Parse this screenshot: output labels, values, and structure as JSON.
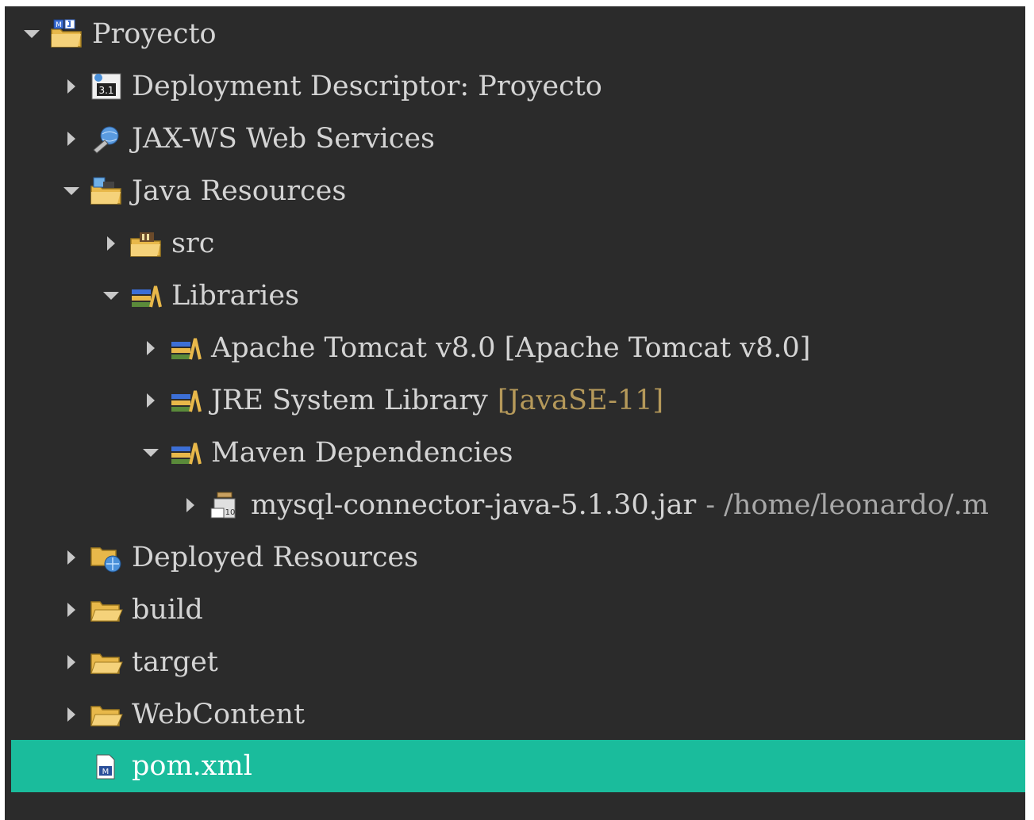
{
  "tree": {
    "items": [
      {
        "label": "Proyecto",
        "level": 0,
        "state": "expanded",
        "icon": "maven-web-project-icon"
      },
      {
        "label": "Deployment Descriptor: Proyecto",
        "level": 1,
        "state": "collapsed",
        "icon": "deployment-descriptor-icon"
      },
      {
        "label": "JAX-WS Web Services",
        "level": 1,
        "state": "collapsed",
        "icon": "web-services-icon"
      },
      {
        "label": "Java Resources",
        "level": 1,
        "state": "expanded",
        "icon": "java-resources-icon"
      },
      {
        "label": "src",
        "level": 2,
        "state": "collapsed",
        "icon": "source-folder-icon"
      },
      {
        "label": "Libraries",
        "level": 2,
        "state": "expanded",
        "icon": "library-icon"
      },
      {
        "label": "Apache Tomcat v8.0 [Apache Tomcat v8.0]",
        "level": 3,
        "state": "collapsed",
        "icon": "library-icon"
      },
      {
        "label": "JRE System Library",
        "decoration": "[JavaSE-11]",
        "level": 3,
        "state": "collapsed",
        "icon": "library-icon"
      },
      {
        "label": "Maven Dependencies",
        "level": 3,
        "state": "expanded",
        "icon": "library-icon"
      },
      {
        "label": "mysql-connector-java-5.1.30.jar",
        "decoration": "- /home/leonardo/.m",
        "level": 4,
        "state": "collapsed",
        "icon": "jar-icon"
      },
      {
        "label": "Deployed Resources",
        "level": 1,
        "state": "collapsed",
        "icon": "deployed-resources-icon"
      },
      {
        "label": "build",
        "level": 1,
        "state": "collapsed",
        "icon": "folder-icon"
      },
      {
        "label": "target",
        "level": 1,
        "state": "collapsed",
        "icon": "folder-icon"
      },
      {
        "label": "WebContent",
        "level": 1,
        "state": "collapsed",
        "icon": "folder-icon"
      },
      {
        "label": "pom.xml",
        "level": 1,
        "state": "none",
        "icon": "maven-pom-icon",
        "selected": true
      }
    ]
  },
  "colors": {
    "background": "#2b2b2b",
    "text": "#d4d4d4",
    "selection": "#1abc9c",
    "decoration": "#b5995a"
  }
}
